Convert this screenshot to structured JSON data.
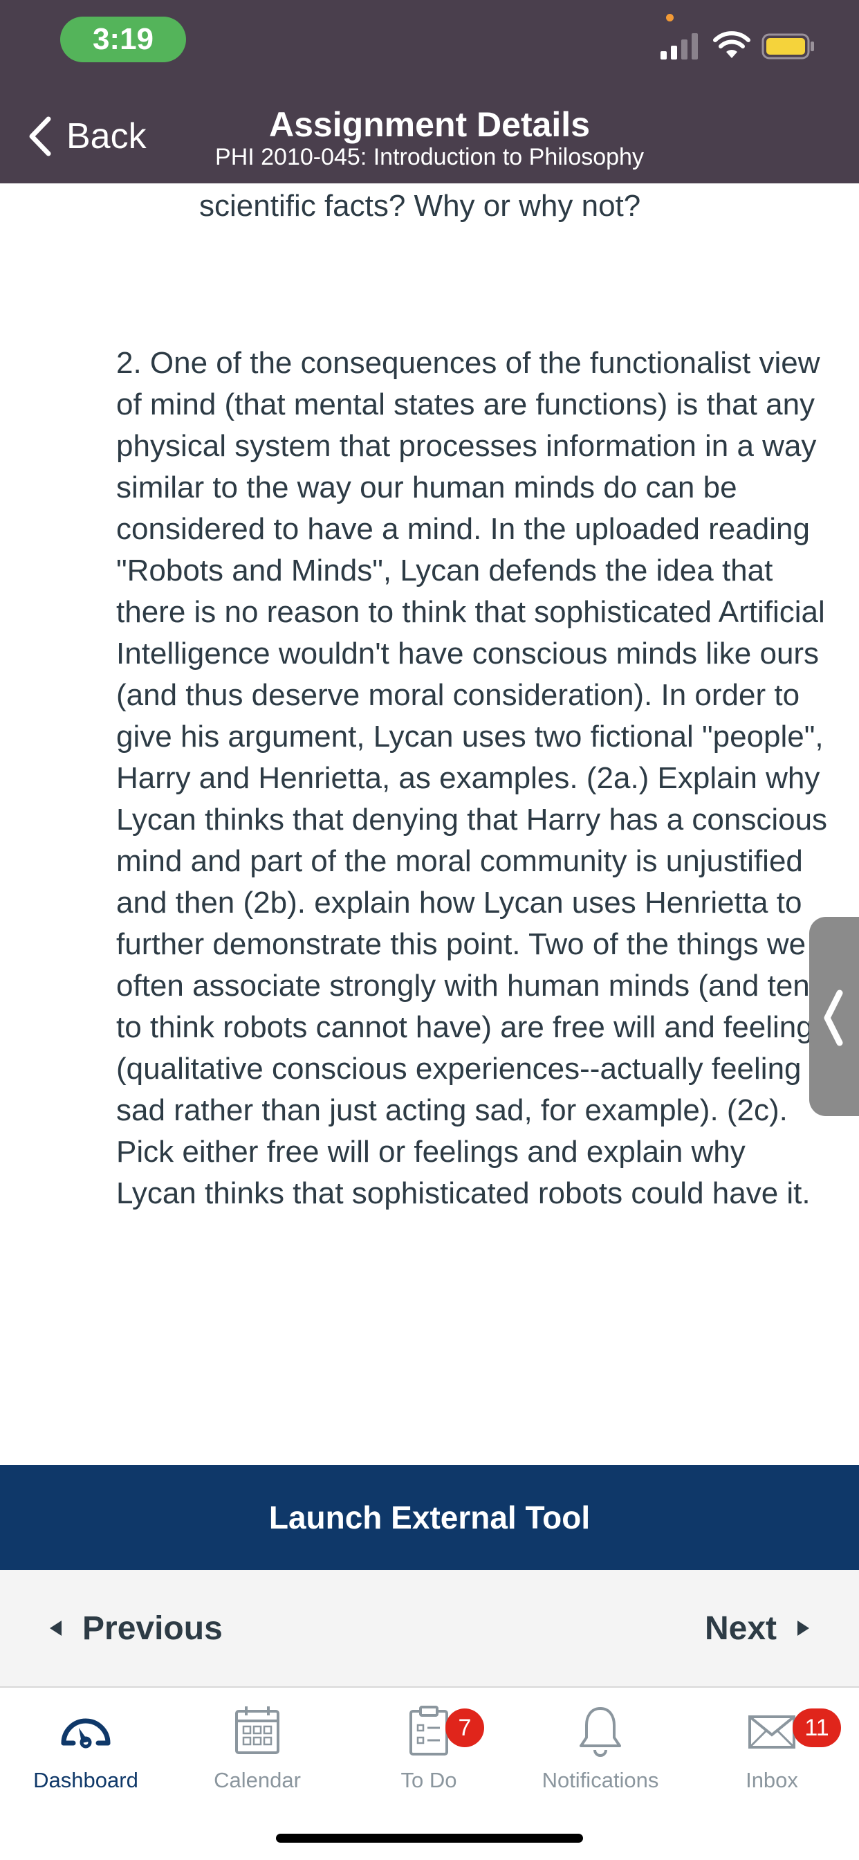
{
  "status_bar": {
    "time": "3:19"
  },
  "header": {
    "back_label": "Back",
    "title": "Assignment Details",
    "subtitle": "PHI 2010-045: Introduction to Philosophy",
    "background_color": "#4a3f4d"
  },
  "content": {
    "cut_off_text": "and self could be similarly falsified by scientific facts? Why or why not?",
    "question_text": "2. One of the consequences of the functionalist view of mind (that mental states are functions) is that any physical system that processes information in a way similar to the way our human minds do can be considered to have a mind. In the uploaded reading \"Robots and Minds\", Lycan defends the idea that there is no reason to think that sophisticated Artificial Intelligence wouldn't have conscious minds like ours (and thus deserve moral consideration). In order to give his argument, Lycan uses two fictional \"people\", Harry and Henrietta, as examples. (2a.) Explain why Lycan thinks that denying that Harry has a conscious mind and part of the moral community is unjustified and then (2b). explain how Lycan uses Henrietta to further demonstrate this point.  Two of the things we often associate strongly with human minds (and tend to think robots cannot have) are free will and feelings (qualitative conscious experiences--actually feeling sad rather than just acting sad, for example). (2c). Pick either free will or feelings and explain why Lycan thinks that sophisticated robots could have it."
  },
  "launch_button": {
    "label": "Launch External Tool",
    "color": "#0f3869"
  },
  "pager": {
    "previous_label": "Previous",
    "next_label": "Next"
  },
  "tabbar": {
    "tabs": [
      {
        "label": "Dashboard",
        "icon": "dashboard-icon",
        "active": true
      },
      {
        "label": "Calendar",
        "icon": "calendar-icon",
        "active": false
      },
      {
        "label": "To Do",
        "icon": "todo-icon",
        "active": false,
        "badge": "7"
      },
      {
        "label": "Notifications",
        "icon": "bell-icon",
        "active": false
      },
      {
        "label": "Inbox",
        "icon": "mail-icon",
        "active": false,
        "badge": "11"
      }
    ],
    "badge_color": "#e0251b"
  }
}
